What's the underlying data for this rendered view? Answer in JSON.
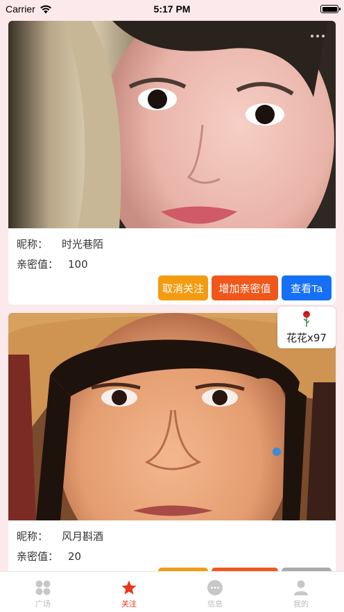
{
  "status_bar": {
    "carrier": "Carrier",
    "time": "5:17 PM"
  },
  "labels": {
    "nickname": "昵称：",
    "intimacy": "亲密值："
  },
  "cards": [
    {
      "nickname": "时光巷陌",
      "intimacy": "100",
      "buttons": {
        "unfollow": "取消关注",
        "add_intimacy": "增加亲密值",
        "view": "查看Ta"
      }
    },
    {
      "nickname": "风月斟酒",
      "intimacy": "20"
    }
  ],
  "flower_badge": {
    "text": "花花x97",
    "icon": "rose-icon"
  },
  "tabs": [
    {
      "label": "广场",
      "icon": "grid-icon",
      "active": false
    },
    {
      "label": "关注",
      "icon": "star-icon",
      "active": true
    },
    {
      "label": "信息",
      "icon": "chat-icon",
      "active": false
    },
    {
      "label": "我的",
      "icon": "person-icon",
      "active": false
    }
  ],
  "colors": {
    "background": "#fbe9ec",
    "unfollow": "#f39c12",
    "add_intimacy": "#f0571b",
    "view": "#1570f5",
    "tab_active": "#e8351e",
    "tab_inactive": "#bbbbbb"
  }
}
